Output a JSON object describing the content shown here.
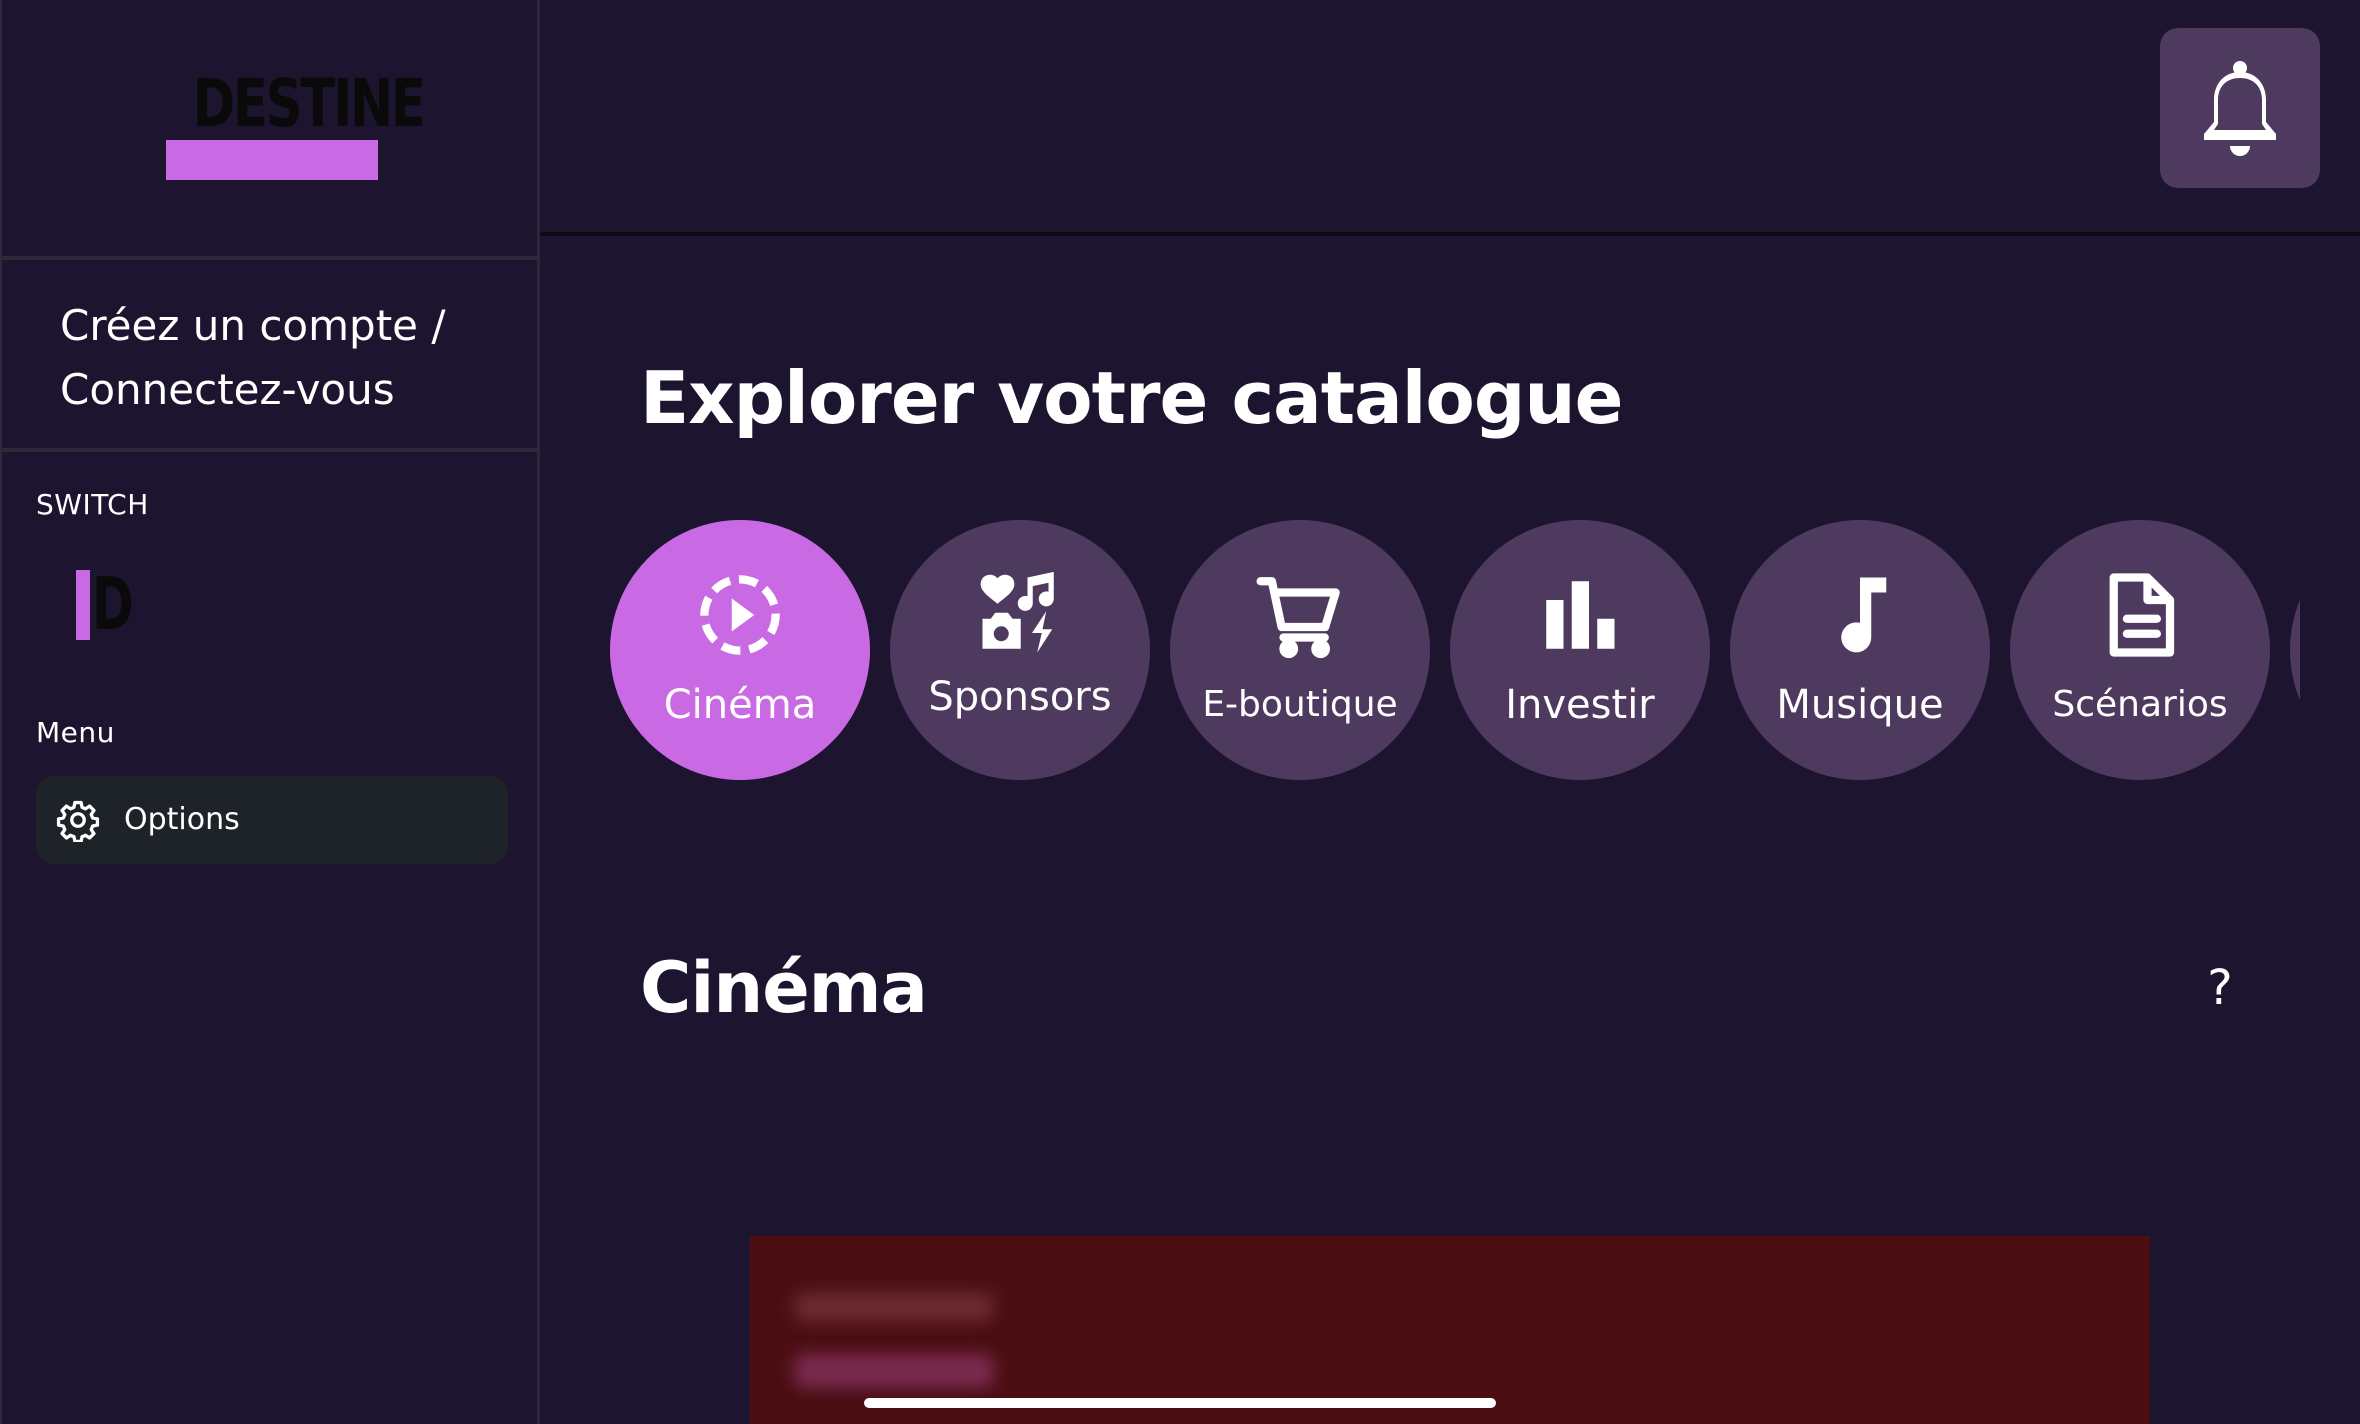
{
  "sidebar": {
    "logo_text": "DESTINE",
    "account_link": "Créez un compte / Connectez-vous",
    "switch_label": "SWITCH",
    "switch_logo_text": "D",
    "menu_label": "Menu",
    "options_label": "Options"
  },
  "header": {
    "notification_icon": "bell-icon"
  },
  "main": {
    "title": "Explorer votre catalogue",
    "categories": [
      {
        "label": "Cinéma",
        "icon": "play-circle-icon",
        "active": true
      },
      {
        "label": "Sponsors",
        "icon": "sponsors-icon",
        "active": false
      },
      {
        "label": "E-boutique",
        "icon": "cart-icon",
        "active": false
      },
      {
        "label": "Investir",
        "icon": "bar-chart-icon",
        "active": false
      },
      {
        "label": "Musique",
        "icon": "music-note-icon",
        "active": false
      },
      {
        "label": "Scénarios",
        "icon": "document-icon",
        "active": false
      }
    ],
    "section_title": "Cinéma",
    "help_label": "?"
  },
  "colors": {
    "background": "#1d1530",
    "accent": "#c96ae4",
    "chip": "#4e3a5e",
    "banner": "#4b0e12"
  }
}
